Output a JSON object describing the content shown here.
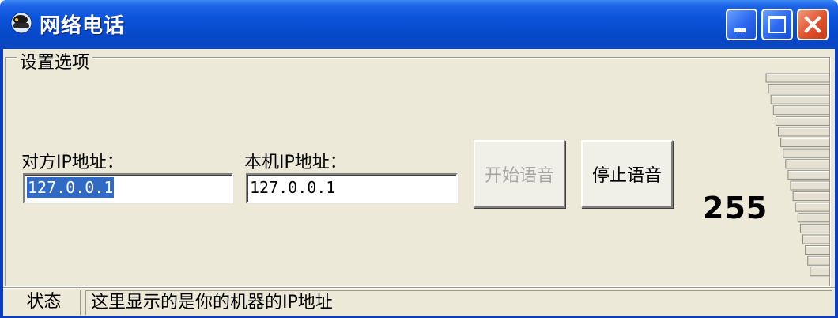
{
  "window": {
    "title": "网络电话",
    "icon": "app-icon",
    "buttons": [
      "minimize-icon",
      "maximize-icon",
      "close-icon"
    ]
  },
  "settings": {
    "group_title": "设置选项",
    "remote_ip_label": "对方IP地址：",
    "remote_ip_value": "127.0.0.1",
    "local_ip_label": "本机IP地址：",
    "local_ip_value": "127.0.0.1",
    "start_button": "开始语音",
    "stop_button": "停止语音",
    "level_value": "255"
  },
  "status": {
    "label": "状态",
    "text": "这里显示的是你的机器的IP地址"
  },
  "colors": {
    "titlebar": "#0a52d8",
    "selection": "#316ac5",
    "client": "#ece9d8",
    "close": "#e0512d"
  }
}
